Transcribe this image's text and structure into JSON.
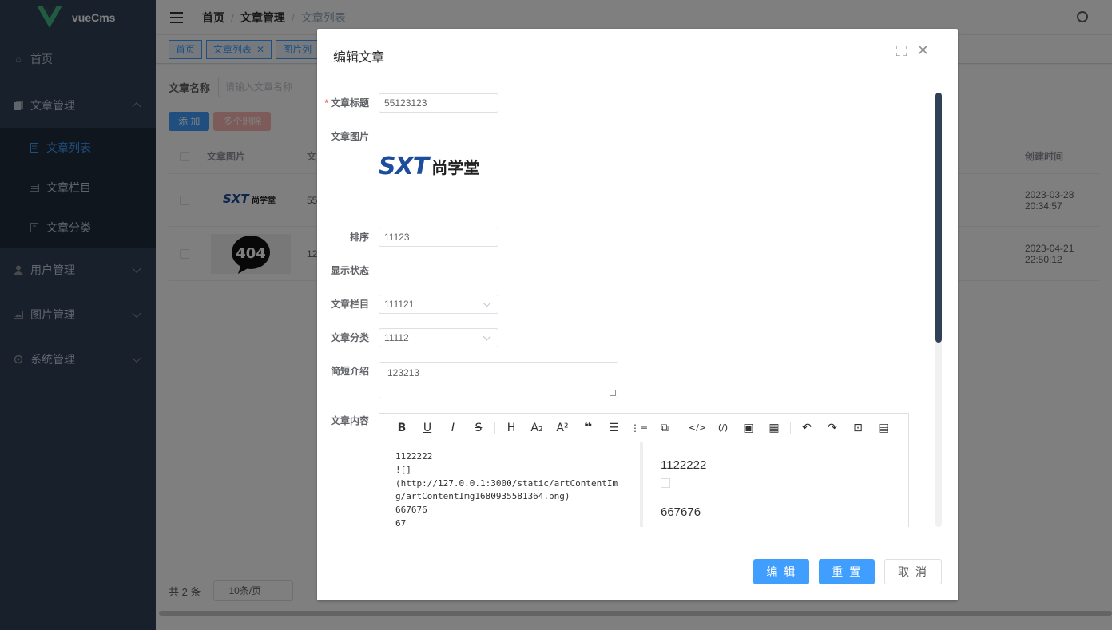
{
  "app": {
    "name": "vueCms"
  },
  "sidebar": {
    "items": [
      {
        "label": "首页",
        "icon": "home-icon"
      },
      {
        "label": "文章管理",
        "icon": "document-copy-icon",
        "expanded": true,
        "children": [
          {
            "label": "文章列表",
            "icon": "document-icon",
            "active": true
          },
          {
            "label": "文章栏目",
            "icon": "tickets-icon"
          },
          {
            "label": "文章分类",
            "icon": "notebook-icon"
          }
        ]
      },
      {
        "label": "用户管理",
        "icon": "user-icon"
      },
      {
        "label": "图片管理",
        "icon": "picture-icon"
      },
      {
        "label": "系统管理",
        "icon": "setting-icon"
      }
    ]
  },
  "breadcrumb": [
    "首页",
    "文章管理",
    "文章列表"
  ],
  "tags": [
    {
      "label": "首页",
      "closable": false
    },
    {
      "label": "文章列表",
      "closable": true
    },
    {
      "label": "图片列",
      "closable": false
    }
  ],
  "search": {
    "label": "文章名称",
    "placeholder": "请输入文章名称"
  },
  "toolbar": {
    "add": "添 加",
    "batch_delete": "多个删除"
  },
  "table": {
    "columns": {
      "image": "文章图片",
      "title": "文",
      "created": "创建时间"
    },
    "rows": [
      {
        "title": "55",
        "created": "2023-03-28 20:34:57",
        "image_alt": "SXT尚学堂"
      },
      {
        "title": "12",
        "created": "2023-04-21 22:50:12",
        "image_alt": "404"
      }
    ]
  },
  "pager": {
    "total": "共 2 条",
    "size": "10条/页"
  },
  "dialog": {
    "title": "编辑文章",
    "form": {
      "title_label": "文章标题",
      "title_value": "55123123",
      "image_label": "文章图片",
      "image_text_en": "SXT",
      "image_text_cn": "尚学堂",
      "sort_label": "排序",
      "sort_value": "11123",
      "status_label": "显示状态",
      "column_label": "文章栏目",
      "column_value": "111121",
      "category_label": "文章分类",
      "category_value": "11112",
      "intro_label": "简短介绍",
      "intro_value": "123213",
      "content_label": "文章内容"
    },
    "editor": {
      "source": "1122222\n![]\n(http://127.0.0.1:3000/static/artContentImg/artContentImg1680935581364.png)\n667676\n67",
      "preview_line1": "1122222",
      "preview_line2": "667676"
    },
    "buttons": {
      "edit": "编 辑",
      "reset": "重 置",
      "cancel": "取 消"
    }
  },
  "colors": {
    "sidebar": "#304156",
    "submenu": "#1f2d3d",
    "primary": "#409eff",
    "danger_light": "#fab6b6"
  }
}
